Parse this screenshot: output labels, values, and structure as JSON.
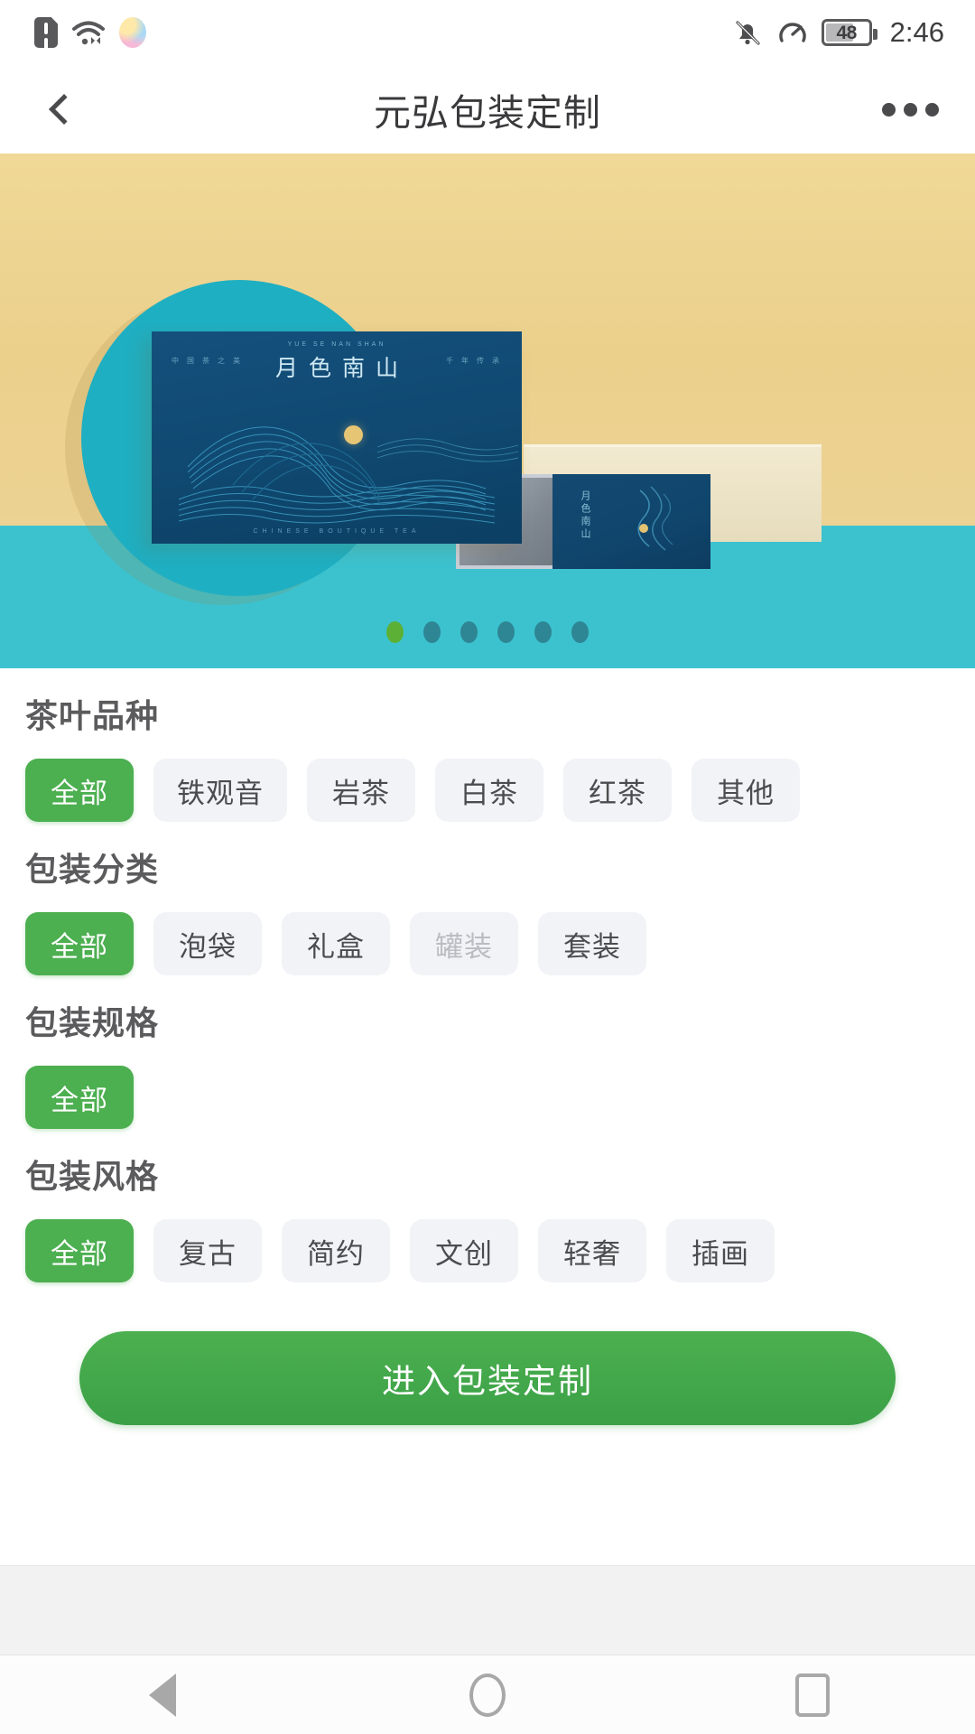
{
  "status_bar": {
    "left_icons": [
      "alert-badge-icon",
      "wifi-icon",
      "photos-gradient-icon"
    ],
    "right_icons": [
      "bell-mute-icon",
      "speedometer-icon"
    ],
    "battery_level": "48",
    "time": "2:46"
  },
  "titlebar": {
    "back_icon": "chevron-left-icon",
    "title": "元弘包装定制",
    "more_icon": "more-horizontal-icon"
  },
  "banner": {
    "hero_title": "月色南山",
    "hero_pinyin": "YUE SE NAN SHAN",
    "hero_side_left": "中国茶之美",
    "hero_side_right": "千年传承",
    "hero_footer": "CHINESE  BOUTIQUE  TEA",
    "small_box_text": "月色南山",
    "colors": {
      "background_top": "#ecd293",
      "background_bottom": "#3cc2cf",
      "circle": "#1fafc2",
      "box_navy": "#104a73",
      "box_cream": "#ece3c6",
      "box_silver": "#8b939c",
      "moon": "#e6c575"
    },
    "dots": {
      "count": 6,
      "active_index": 0,
      "active_color": "#5cb036",
      "inactive_color": "#2e8593"
    }
  },
  "filters": [
    {
      "title": "茶叶品种",
      "options": [
        {
          "label": "全部",
          "state": "active"
        },
        {
          "label": "铁观音",
          "state": "normal"
        },
        {
          "label": "岩茶",
          "state": "normal"
        },
        {
          "label": "白茶",
          "state": "normal"
        },
        {
          "label": "红茶",
          "state": "normal"
        },
        {
          "label": "其他",
          "state": "normal"
        }
      ]
    },
    {
      "title": "包装分类",
      "options": [
        {
          "label": "全部",
          "state": "active"
        },
        {
          "label": "泡袋",
          "state": "normal"
        },
        {
          "label": "礼盒",
          "state": "normal"
        },
        {
          "label": "罐装",
          "state": "disabled"
        },
        {
          "label": "套装",
          "state": "normal"
        }
      ]
    },
    {
      "title": "包装规格",
      "options": [
        {
          "label": "全部",
          "state": "active"
        }
      ]
    },
    {
      "title": "包装风格",
      "options": [
        {
          "label": "全部",
          "state": "active"
        },
        {
          "label": "复古",
          "state": "normal"
        },
        {
          "label": "简约",
          "state": "normal"
        },
        {
          "label": "文创",
          "state": "normal"
        },
        {
          "label": "轻奢",
          "state": "normal"
        },
        {
          "label": "插画",
          "state": "normal"
        }
      ]
    }
  ],
  "cta": {
    "label": "进入包装定制",
    "color": "#44a849"
  },
  "navbar": {
    "back_icon": "triangle-back-icon",
    "home_icon": "circle-home-icon",
    "recents_icon": "square-recents-icon"
  }
}
